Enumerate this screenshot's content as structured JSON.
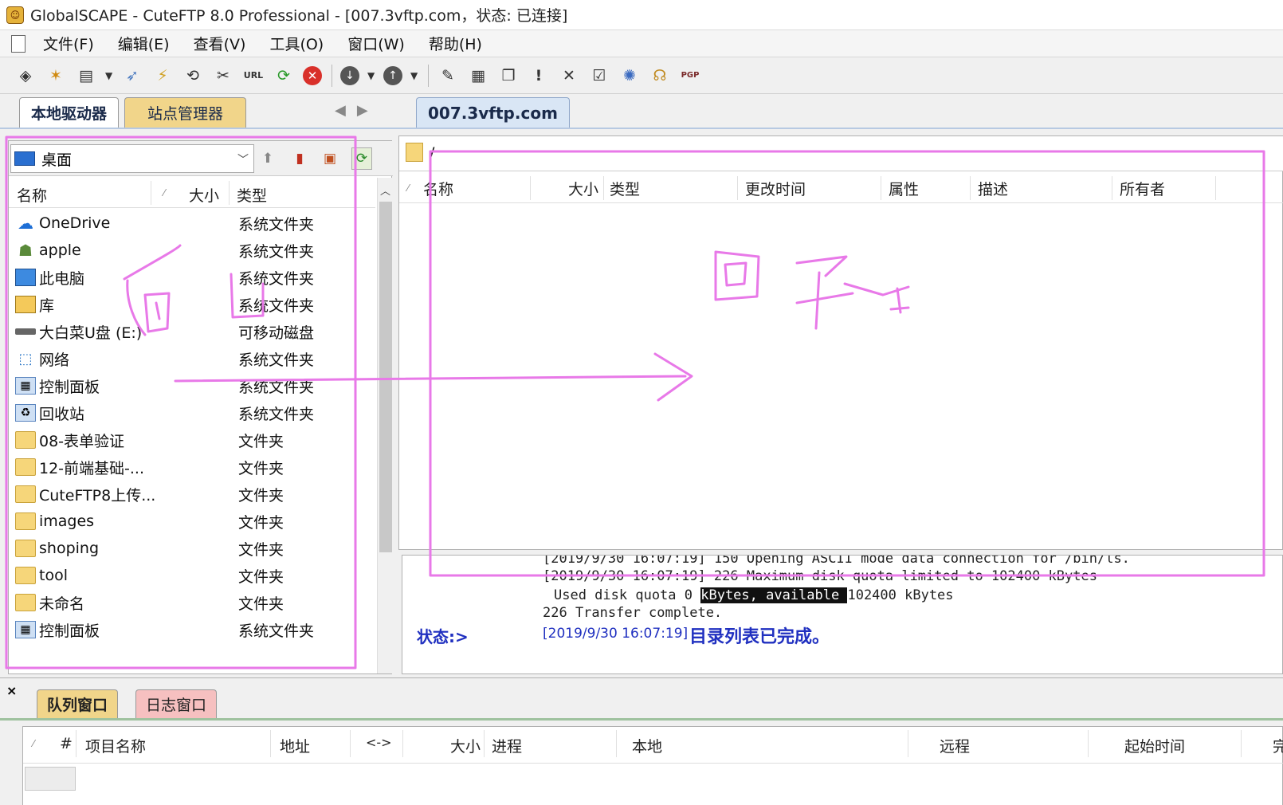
{
  "window": {
    "title": "GlobalSCAPE - CuteFTP 8.0 Professional - [007.3vftp.com，状态: 已连接]"
  },
  "menu": [
    "文件(F)",
    "编辑(E)",
    "查看(V)",
    "工具(O)",
    "窗口(W)",
    "帮助(H)"
  ],
  "toolbar": {
    "icons": [
      "open-site-icon",
      "wizard-icon",
      "new-icon",
      "connect-icon",
      "quick-connect-icon",
      "reconnect-icon",
      "disconnect-icon",
      "url-icon",
      "refresh-icon",
      "stop-icon",
      "download-icon",
      "upload-icon",
      "edit-icon",
      "compare-icon",
      "folder-icon",
      "execute-icon",
      "delete-icon",
      "properties-icon",
      "sync-icon",
      "help-icon",
      "pgp-icon"
    ]
  },
  "left_tabs": {
    "local": "本地驱动器",
    "site_manager": "站点管理器"
  },
  "remote_tab": "007.3vftp.com",
  "local": {
    "path": "桌面",
    "columns": {
      "name": "名称",
      "size": "大小",
      "type": "类型"
    },
    "files": [
      {
        "name": "OneDrive",
        "type": "系统文件夹",
        "icon": "cloud-icon"
      },
      {
        "name": "apple",
        "type": "系统文件夹",
        "icon": "user-icon"
      },
      {
        "name": "此电脑",
        "type": "系统文件夹",
        "icon": "computer-icon"
      },
      {
        "name": "库",
        "type": "系统文件夹",
        "icon": "library-icon"
      },
      {
        "name": "大白菜U盘 (E:)",
        "type": "可移动磁盘",
        "icon": "drive-icon"
      },
      {
        "name": "网络",
        "type": "系统文件夹",
        "icon": "network-icon"
      },
      {
        "name": "控制面板",
        "type": "系统文件夹",
        "icon": "control-panel-icon"
      },
      {
        "name": "回收站",
        "type": "系统文件夹",
        "icon": "recycle-bin-icon"
      },
      {
        "name": "08-表单验证",
        "type": "文件夹",
        "icon": "folder-icon"
      },
      {
        "name": "12-前端基础-...",
        "type": "文件夹",
        "icon": "folder-icon"
      },
      {
        "name": "CuteFTP8上传...",
        "type": "文件夹",
        "icon": "folder-icon"
      },
      {
        "name": "images",
        "type": "文件夹",
        "icon": "folder-icon"
      },
      {
        "name": "shoping",
        "type": "文件夹",
        "icon": "folder-icon"
      },
      {
        "name": "tool",
        "type": "文件夹",
        "icon": "folder-icon"
      },
      {
        "name": "未命名",
        "type": "文件夹",
        "icon": "folder-icon"
      },
      {
        "name": "控制面板",
        "type": "系统文件夹",
        "icon": "control-panel-icon"
      }
    ]
  },
  "remote": {
    "path": "/",
    "columns": [
      "名称",
      "大小",
      "类型",
      "更改时间",
      "属性",
      "描述",
      "所有者"
    ]
  },
  "log": {
    "lines": [
      "[2019/9/30 16:07:19] 150 Opening ASCII mode data connection for /bin/ls.",
      "[2019/9/30 16:07:19] 226 Maximum disk quota limited to 102400 kBytes"
    ],
    "quota_prefix": "Used disk quota 0 ",
    "quota_highlight": "kBytes, available ",
    "quota_suffix": "102400 kBytes",
    "transfer": "226 Transfer complete.",
    "status_label": "状态:>",
    "status_time": "[2019/9/30 16:07:19]",
    "status_message": "目录列表已完成。"
  },
  "queue": {
    "tabs": {
      "queue": "队列窗口",
      "log": "日志窗口"
    },
    "columns": [
      "#",
      "项目名称",
      "地址",
      "<->",
      "大小",
      "进程",
      "本地",
      "远程",
      "起始时间",
      "完"
    ]
  },
  "annotations": {
    "handwriting_left": "本地",
    "handwriting_right": "远程"
  }
}
